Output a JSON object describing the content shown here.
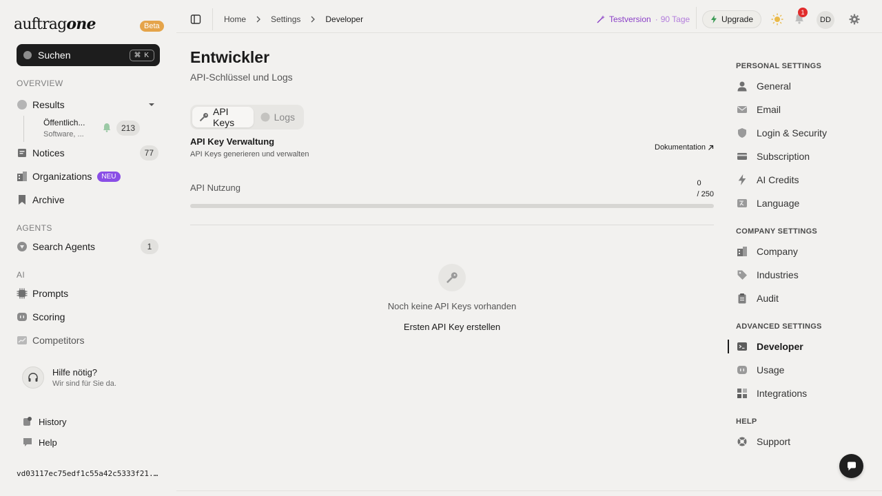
{
  "brand": {
    "logo_light": "auftrag",
    "logo_bold": "one",
    "badge": "Beta"
  },
  "search": {
    "label": "Suchen",
    "shortcut": "⌘ K"
  },
  "sidebar": {
    "section_overview": "OVERVIEW",
    "results": {
      "label": "Results"
    },
    "results_sub": {
      "title": "Öffentlich...",
      "subtitle": "Software, ...",
      "count": "213"
    },
    "notices": {
      "label": "Notices",
      "count": "77"
    },
    "organizations": {
      "label": "Organizations",
      "badge": "NEU"
    },
    "archive": {
      "label": "Archive"
    },
    "section_agents": "AGENTS",
    "search_agents": {
      "label": "Search Agents",
      "count": "1"
    },
    "section_ai": "AI",
    "prompts": {
      "label": "Prompts"
    },
    "scoring": {
      "label": "Scoring"
    },
    "competitors": {
      "label": "Competitors"
    },
    "help_card": {
      "title": "Hilfe nötig?",
      "subtitle": "Wir sind für Sie da."
    },
    "history": {
      "label": "History"
    },
    "help": {
      "label": "Help"
    },
    "version_hash": "vd03117ec75edf1c55a42c5333f21..."
  },
  "topbar": {
    "breadcrumbs": [
      "Home",
      "Settings",
      "Developer"
    ],
    "trial": {
      "label": "Testversion",
      "days": "90 Tage"
    },
    "upgrade": "Upgrade",
    "notifications_count": "1",
    "avatar": "DD"
  },
  "main": {
    "title": "Entwickler",
    "subtitle": "API-Schlüssel und Logs",
    "tabs": [
      {
        "label": "API Keys"
      },
      {
        "label": "Logs"
      }
    ],
    "card_title": "API Key Verwaltung",
    "card_subtitle": "API Keys generieren und verwalten",
    "docs_link": "Dokumentation",
    "usage_label": "API Nutzung",
    "usage_used": "0",
    "usage_limit": "/ 250",
    "usage_fraction": 0,
    "empty_text": "Noch keine API Keys vorhanden",
    "create_button": "Ersten API Key erstellen"
  },
  "settings_nav": {
    "personal_title": "PERSONAL SETTINGS",
    "personal": [
      "General",
      "Email",
      "Login & Security",
      "Subscription",
      "AI Credits",
      "Language"
    ],
    "company_title": "COMPANY SETTINGS",
    "company": [
      "Company",
      "Industries",
      "Audit"
    ],
    "advanced_title": "ADVANCED SETTINGS",
    "advanced": [
      "Developer",
      "Usage",
      "Integrations"
    ],
    "help_title": "HELP",
    "help": [
      "Support"
    ]
  },
  "colors": {
    "accent_purple": "#8a4ee6",
    "beta_orange": "#e5a44a",
    "badge_red": "#e12c2c"
  }
}
